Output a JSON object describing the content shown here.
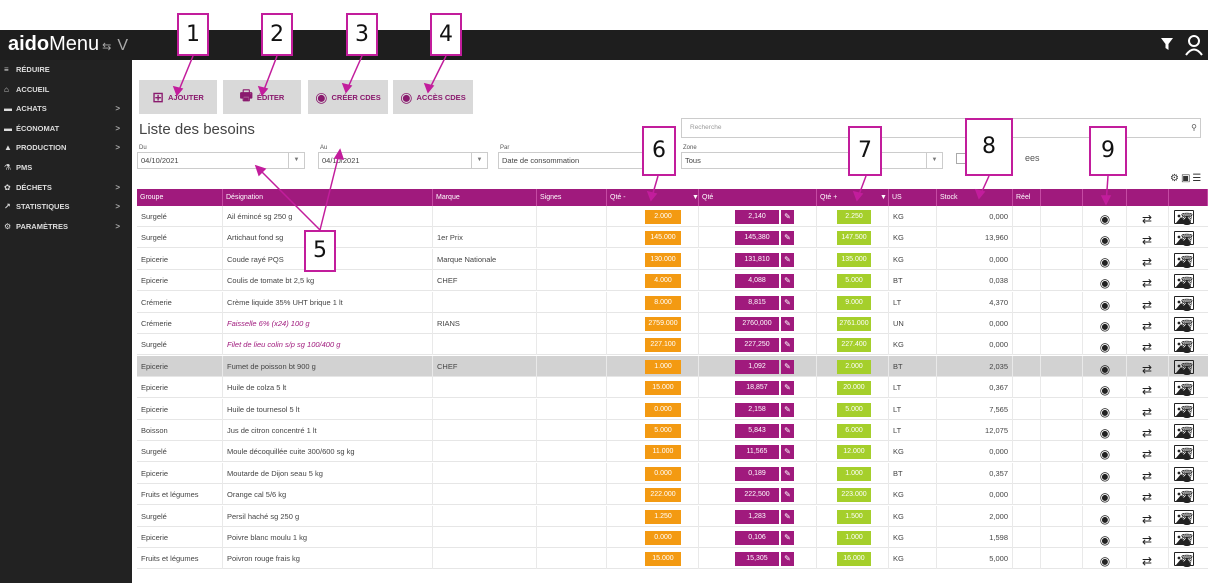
{
  "header": {
    "logo_bold": "aido",
    "logo_rest": "Menu",
    "logo_sup": "⇆",
    "logo_extra": "V",
    "filter_icon": "filter-icon",
    "user_icon": "user-icon"
  },
  "sidebar": {
    "items": [
      {
        "icon": "≡",
        "label": "RÉDUIRE",
        "chevron": ""
      },
      {
        "icon": "⌂",
        "label": "ACCUEIL",
        "chevron": ""
      },
      {
        "icon": "▬",
        "label": "ACHATS",
        "chevron": ">"
      },
      {
        "icon": "▬",
        "label": "ÉCONOMAT",
        "chevron": ">"
      },
      {
        "icon": "▲",
        "label": "PRODUCTION",
        "chevron": ">"
      },
      {
        "icon": "⚗",
        "label": "PMS",
        "chevron": ""
      },
      {
        "icon": "✿",
        "label": "DÉCHETS",
        "chevron": ">"
      },
      {
        "icon": "↗",
        "label": "STATISTIQUES",
        "chevron": ">"
      },
      {
        "icon": "⚙",
        "label": "PARAMÈTRES",
        "chevron": ">"
      }
    ]
  },
  "toolbar": {
    "add_label": "AJOUTER",
    "print_label": "ÉDITER",
    "create_label": "CRÉER CDES",
    "access_label": "ACCÈS CDES"
  },
  "page": {
    "title": "Liste des besoins"
  },
  "filters": {
    "du_label": "Du",
    "du_value": "04/10/2021",
    "au_label": "Au",
    "au_value": "04/10/2021",
    "par_label": "Par",
    "par_value": "Date de consommation",
    "zone_label": "Zone",
    "zone_value": "Tous",
    "search_placeholder": "Recherche",
    "checkbox_label": "ees"
  },
  "table": {
    "columns": [
      "Groupe",
      "Désignation",
      "Marque",
      "Signes",
      "Qté -",
      "Qté",
      "Qté +",
      "US",
      "Stock",
      "Réel"
    ],
    "rows": [
      {
        "groupe": "Surgelé",
        "designation": "Ail émincé sg 250 g",
        "marque": "",
        "qmin": "2.000",
        "qte": "2,140",
        "qplus": "2.250",
        "us": "KG",
        "stock": "0,000",
        "italic": false,
        "highlight": false
      },
      {
        "groupe": "Surgelé",
        "designation": "Artichaut fond sg",
        "marque": "1er Prix",
        "qmin": "145.000",
        "qte": "145,380",
        "qplus": "147.500",
        "us": "KG",
        "stock": "13,960",
        "italic": false,
        "highlight": false
      },
      {
        "groupe": "Epicerie",
        "designation": "Coude rayé PQS",
        "marque": "Marque Nationale",
        "qmin": "130.000",
        "qte": "131,810",
        "qplus": "135.000",
        "us": "KG",
        "stock": "0,000",
        "italic": false,
        "highlight": false
      },
      {
        "groupe": "Epicerie",
        "designation": "Coulis de tomate bt 2,5 kg",
        "marque": "CHEF",
        "qmin": "4.000",
        "qte": "4,088",
        "qplus": "5.000",
        "us": "BT",
        "stock": "0,038",
        "italic": false,
        "highlight": false
      },
      {
        "groupe": "Crémerie",
        "designation": "Crème liquide 35% UHT brique 1 lt",
        "marque": "",
        "qmin": "8.000",
        "qte": "8,815",
        "qplus": "9.000",
        "us": "LT",
        "stock": "4,370",
        "italic": false,
        "highlight": false
      },
      {
        "groupe": "Crémerie",
        "designation": "Faisselle 6% (x24) 100 g",
        "marque": "RIANS",
        "qmin": "2759.000",
        "qte": "2760,000",
        "qplus": "2761.000",
        "us": "UN",
        "stock": "0,000",
        "italic": true,
        "highlight": false
      },
      {
        "groupe": "Surgelé",
        "designation": "Filet de lieu colin s/p sg 100/400 g",
        "marque": "",
        "qmin": "227.100",
        "qte": "227,250",
        "qplus": "227.400",
        "us": "KG",
        "stock": "0,000",
        "italic": true,
        "highlight": false
      },
      {
        "groupe": "Epicerie",
        "designation": "Fumet de poisson bt 900 g",
        "marque": "CHEF",
        "qmin": "1.000",
        "qte": "1,092",
        "qplus": "2.000",
        "us": "BT",
        "stock": "2,035",
        "italic": false,
        "highlight": true
      },
      {
        "groupe": "Epicerie",
        "designation": "Huile de colza 5 lt",
        "marque": "",
        "qmin": "15.000",
        "qte": "18,857",
        "qplus": "20.000",
        "us": "LT",
        "stock": "0,367",
        "italic": false,
        "highlight": false
      },
      {
        "groupe": "Epicerie",
        "designation": "Huile de tournesol 5 lt",
        "marque": "",
        "qmin": "0.000",
        "qte": "2,158",
        "qplus": "5.000",
        "us": "LT",
        "stock": "7,565",
        "italic": false,
        "highlight": false
      },
      {
        "groupe": "Boisson",
        "designation": "Jus de citron concentré 1 lt",
        "marque": "",
        "qmin": "5.000",
        "qte": "5,843",
        "qplus": "6.000",
        "us": "LT",
        "stock": "12,075",
        "italic": false,
        "highlight": false
      },
      {
        "groupe": "Surgelé",
        "designation": "Moule décoquillée cuite 300/600 sg kg",
        "marque": "",
        "qmin": "11.000",
        "qte": "11,565",
        "qplus": "12.000",
        "us": "KG",
        "stock": "0,000",
        "italic": false,
        "highlight": false
      },
      {
        "groupe": "Epicerie",
        "designation": "Moutarde de Dijon seau 5 kg",
        "marque": "",
        "qmin": "0.000",
        "qte": "0,189",
        "qplus": "1.000",
        "us": "BT",
        "stock": "0,357",
        "italic": false,
        "highlight": false
      },
      {
        "groupe": "Fruits et légumes",
        "designation": "Orange cal 5/6 kg",
        "marque": "",
        "qmin": "222.000",
        "qte": "222,500",
        "qplus": "223.000",
        "us": "KG",
        "stock": "0,000",
        "italic": false,
        "highlight": false
      },
      {
        "groupe": "Surgelé",
        "designation": "Persil haché sg 250 g",
        "marque": "",
        "qmin": "1.250",
        "qte": "1,283",
        "qplus": "1.500",
        "us": "KG",
        "stock": "2,000",
        "italic": false,
        "highlight": false
      },
      {
        "groupe": "Epicerie",
        "designation": "Poivre blanc moulu 1 kg",
        "marque": "",
        "qmin": "0.000",
        "qte": "0,106",
        "qplus": "1.000",
        "us": "KG",
        "stock": "1,598",
        "italic": false,
        "highlight": false
      },
      {
        "groupe": "Fruits et légumes",
        "designation": "Poivron rouge frais kg",
        "marque": "",
        "qmin": "15.000",
        "qte": "15,305",
        "qplus": "16.000",
        "us": "KG",
        "stock": "5,000",
        "italic": false,
        "highlight": false
      }
    ]
  },
  "annotations": [
    "1",
    "2",
    "3",
    "4",
    "5",
    "6",
    "7",
    "8",
    "9"
  ],
  "colors": {
    "primary": "#a01a7d",
    "orange": "#f39a12",
    "green": "#a5cf2b",
    "callout_border": "#c21d9c"
  }
}
